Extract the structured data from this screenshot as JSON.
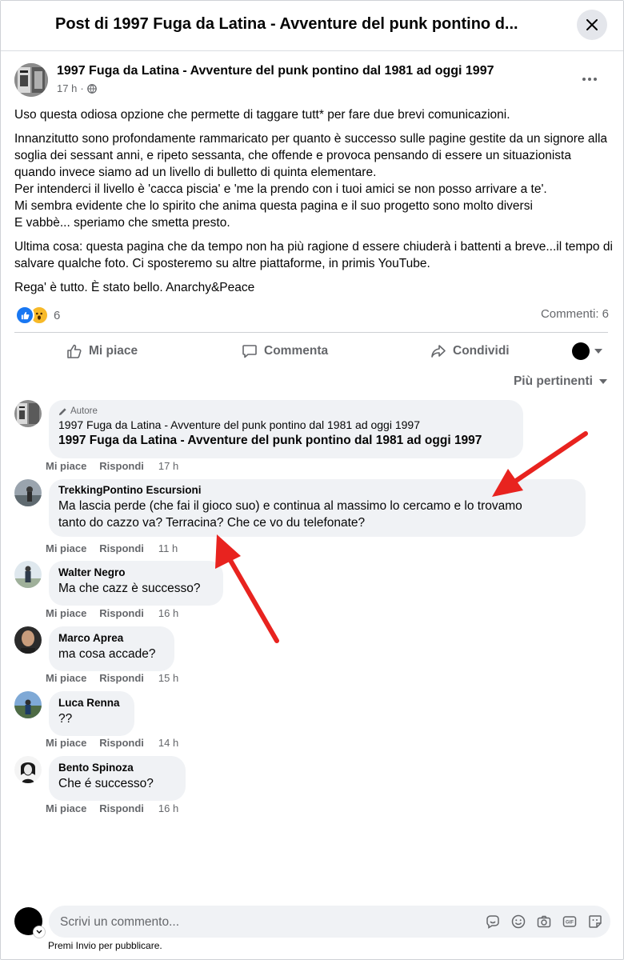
{
  "modal": {
    "title": "Post di 1997 Fuga da Latina - Avventure del punk pontino d...",
    "close_icon": "close-icon"
  },
  "post": {
    "author": "1997 Fuga da Latina - Avventure del punk pontino dal 1981 ad oggi 1997",
    "time": "17 h",
    "privacy_icon": "globe-icon",
    "paragraphs": [
      "Uso questa odiosa opzione che permette di taggare tutt* per fare due brevi comunicazioni.",
      "Innanzitutto sono profondamente rammaricato per quanto è successo sulle pagine gestite da un signore alla soglia dei sessant anni, e ripeto sessanta, che offende e provoca pensando di essere un situazionista quando invece siamo ad un livello di bulletto di quinta elementare.\nPer intenderci il livello è 'cacca piscia'  e 'me la prendo con i tuoi amici se non posso arrivare a te'.\nMi sembra evidente che lo spirito che anima questa pagina e il suo progetto sono molto diversi\nE vabbè... speriamo che smetta presto.",
      "Ultima cosa: questa pagina che da tempo non ha più ragione d essere chiuderà i battenti a breve...il tempo di salvare qualche foto. Ci sposteremo su altre piattaforme, in primis YouTube.",
      "Rega' è tutto. È stato bello. Anarchy&Peace"
    ],
    "reaction_count": "6",
    "comments_count": "Commenti: 6"
  },
  "actions": {
    "like": "Mi piace",
    "comment": "Commenta",
    "share": "Condividi"
  },
  "sort_label": "Più pertinenti",
  "comment_actions": {
    "like": "Mi piace",
    "reply": "Rispondi"
  },
  "comments": [
    {
      "badge": "Autore",
      "name": "1997 Fuga da Latina - Avventure del punk pontino dal 1981 ad oggi 1997",
      "text": "1997 Fuga da Latina - Avventure del punk pontino dal 1981 ad oggi 1997",
      "time": "17 h"
    },
    {
      "name": "TrekkingPontino Escursioni",
      "text": "Ma lascia perde (che fai il gioco suo) e continua al massimo lo cercamo e lo trovamo\ntanto do cazzo va? Terracina? Che ce vo du telefonate?",
      "time": "11 h"
    },
    {
      "name": "Walter Negro",
      "text": "Ma che cazz è successo?",
      "time": "16 h"
    },
    {
      "name": "Marco Aprea",
      "text": "ma cosa accade?",
      "time": "15 h"
    },
    {
      "name": "Luca Renna",
      "text": "??",
      "time": "14 h"
    },
    {
      "name": "Bento Spinoza",
      "text": "Che é successo?",
      "time": "16 h"
    }
  ],
  "composer": {
    "placeholder": "Scrivi un commento...",
    "hint": "Premi Invio per pubblicare.",
    "tools": [
      "sticker-icon",
      "emoji-icon",
      "camera-icon",
      "gif-icon",
      "avatar-sticker-icon"
    ]
  },
  "colors": {
    "annotation_arrow": "#e8231f",
    "link_blue": "#1877f2"
  }
}
